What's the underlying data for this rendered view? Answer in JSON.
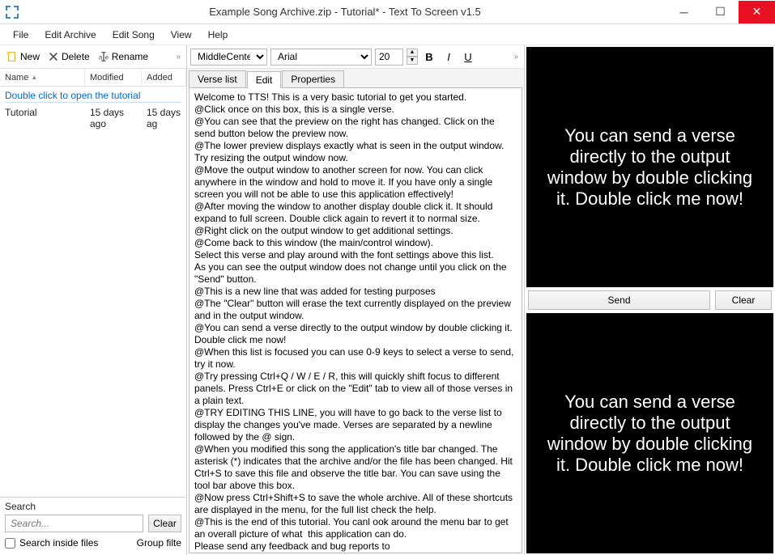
{
  "window": {
    "title": "Example Song Archive.zip - Tutorial* - Text To Screen v1.5"
  },
  "menubar": [
    "File",
    "Edit Archive",
    "Edit Song",
    "View",
    "Help"
  ],
  "left": {
    "toolbar": {
      "new": "New",
      "delete": "Delete",
      "rename": "Rename"
    },
    "columns": {
      "name": "Name",
      "modified": "Modified",
      "added": "Added"
    },
    "hint": "Double click to open the tutorial",
    "rows": [
      {
        "name": "Tutorial",
        "modified": "15 days ago",
        "added": "15 days ag"
      }
    ],
    "search": {
      "label": "Search",
      "placeholder": "Search...",
      "clear": "Clear",
      "inside": "Search inside files",
      "group": "Group filte"
    }
  },
  "mid": {
    "align": "MiddleCenter",
    "font": "Arial",
    "size": "20",
    "tabs": [
      "Verse list",
      "Edit",
      "Properties"
    ],
    "active_tab": 1,
    "editor_text": "Welcome to TTS! This is a very basic tutorial to get you started.\n@Click once on this box, this is a single verse.\n@You can see that the preview on the right has changed. Click on the send button below the preview now.\n@The lower preview displays exactly what is seen in the output window. Try resizing the output window now.\n@Move the output window to another screen for now. You can click anywhere in the window and hold to move it. If you have only a single screen you will not be able to use this application effectively!\n@After moving the window to another display double click it. It should expand to full screen. Double click again to revert it to normal size.\n@Right click on the output window to get additional settings.\n@Come back to this window (the main/control window).\nSelect this verse and play around with the font settings above this list.\nAs you can see the output window does not change until you click on the \"Send\" button.\n@This is a new line that was added for testing purposes\n@The \"Clear\" button will erase the text currently displayed on the preview and in the output window.\n@You can send a verse directly to the output window by double clicking it. Double click me now!\n@When this list is focused you can use 0-9 keys to select a verse to send, try it now.\n@Try pressing Ctrl+Q / W / E / R, this will quickly shift focus to different panels. Press Ctrl+E or click on the \"Edit\" tab to view all of those verses in a plain text.\n@TRY EDITING THIS LINE, you will have to go back to the verse list to display the changes you've made. Verses are separated by a newline followed by the @ sign.\n@When you modified this song the application's title bar changed. The asterisk (*) indicates that the archive and/or the file has been changed. Hit Ctrl+S to save this file and observe the title bar. You can save using the tool bar above this box.\n@Now press Ctrl+Shift+S to save the whole archive. All of these shortcuts are displayed in the menu, for the full list check the help.\n@This is the end of this tutorial. You canl ook around the menu bar to get an overall picture of what  this application can do.\nPlease send any feedback and bug reports to http://klocmansoftware.weebly.com/feedback--contact.html"
  },
  "right": {
    "preview_text": "You can send a verse directly to the output window by double clicking it. Double click me now!",
    "send": "Send",
    "clear": "Clear",
    "output_text": "You can send a verse directly to the output window by double clicking it. Double click me now!"
  }
}
